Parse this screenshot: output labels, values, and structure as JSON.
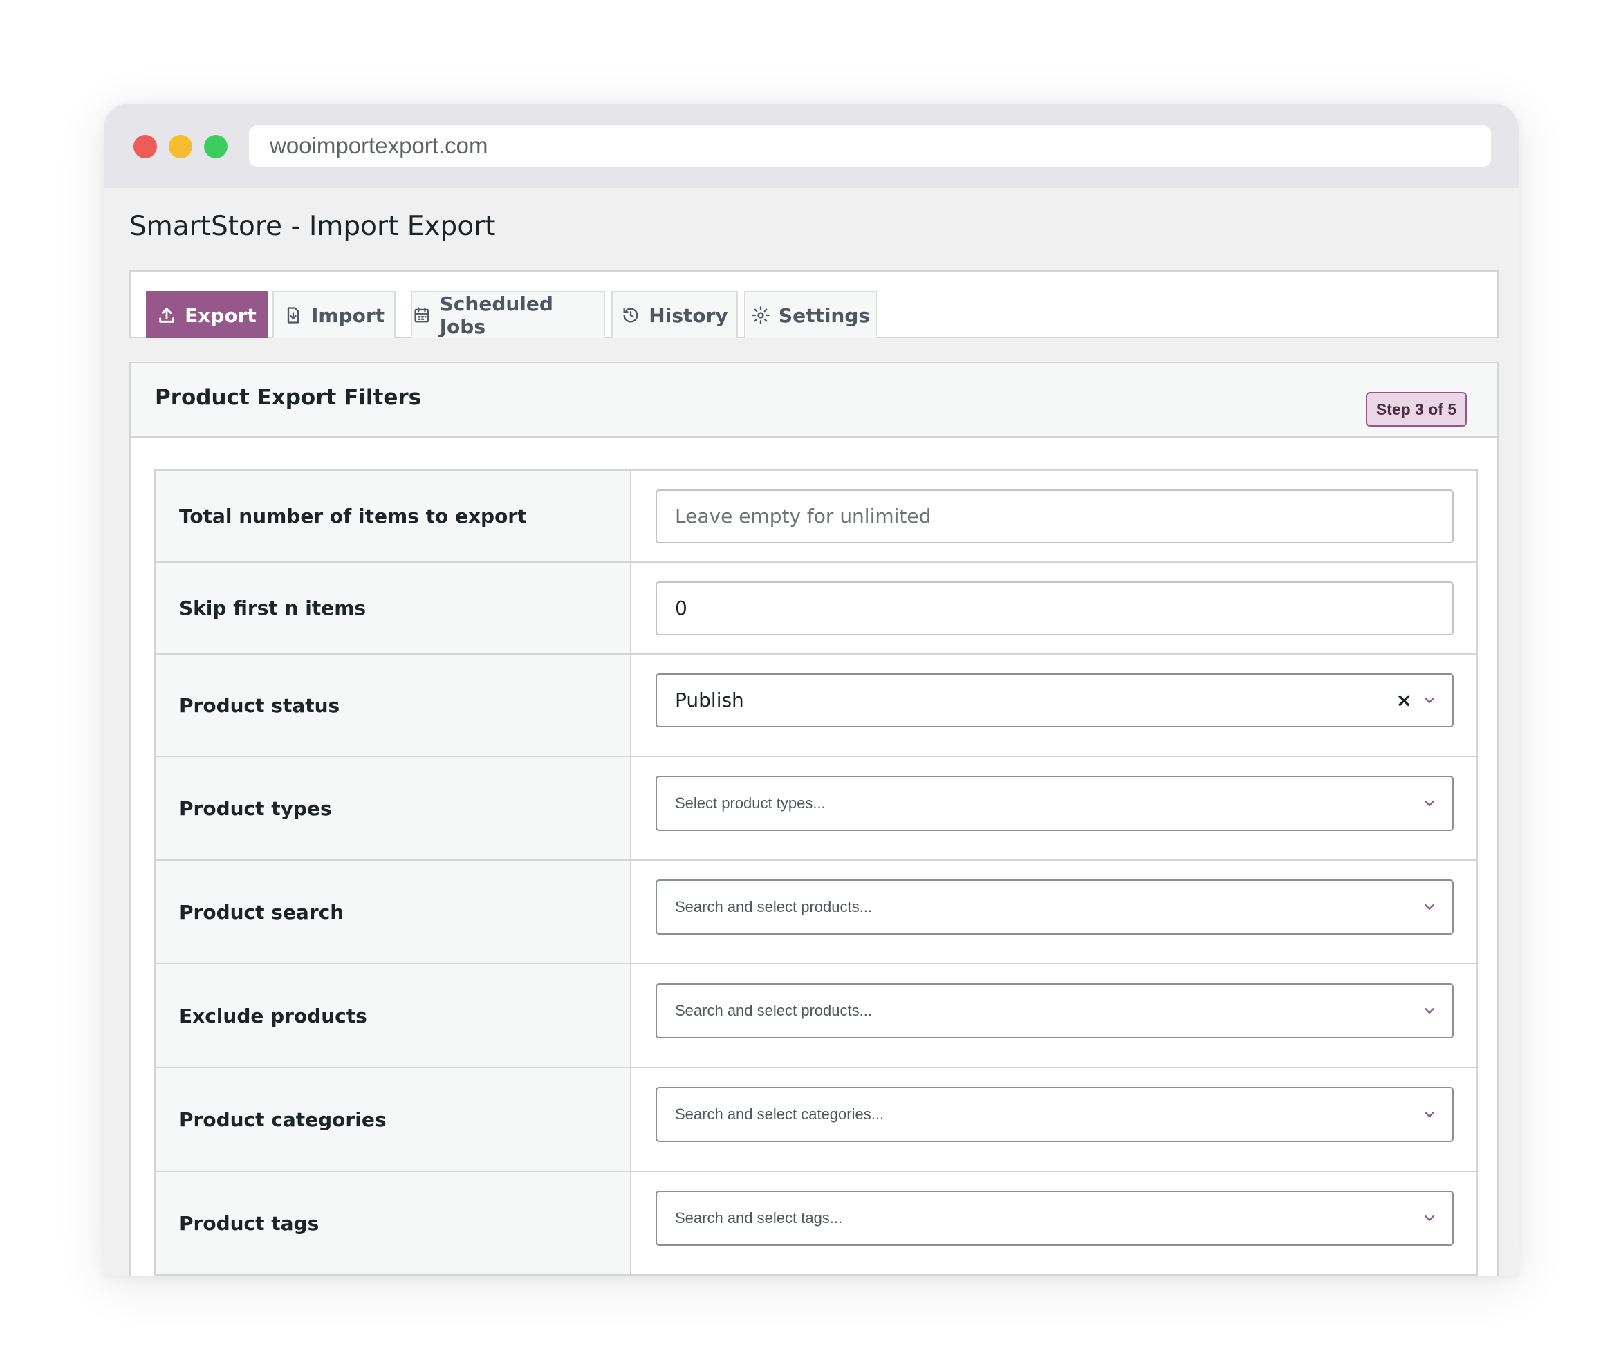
{
  "browser": {
    "url": "wooimportexport.com"
  },
  "app": {
    "title": "SmartStore - Import Export"
  },
  "tabs": [
    {
      "label": "Export",
      "icon": "upload-icon",
      "active": true
    },
    {
      "label": "Import",
      "icon": "import-file-icon",
      "active": false
    },
    {
      "label": "Scheduled Jobs",
      "icon": "calendar-icon",
      "active": false
    },
    {
      "label": "History",
      "icon": "history-icon",
      "active": false
    },
    {
      "label": "Settings",
      "icon": "gear-icon",
      "active": false
    }
  ],
  "panel": {
    "title": "Product Export Filters",
    "step": "Step 3 of 5"
  },
  "fields": {
    "total_items": {
      "label": "Total number of items to export",
      "placeholder": "Leave empty for unlimited",
      "value": ""
    },
    "skip_items": {
      "label": "Skip first n items",
      "value": "0"
    },
    "status": {
      "label": "Product status",
      "value": "Publish",
      "clear": "×"
    },
    "types": {
      "label": "Product types",
      "placeholder": "Select product types..."
    },
    "search": {
      "label": "Product search",
      "placeholder": "Search and select products..."
    },
    "exclude": {
      "label": "Exclude products",
      "placeholder": "Search and select products..."
    },
    "categories": {
      "label": "Product categories",
      "placeholder": "Search and select categories..."
    },
    "tags": {
      "label": "Product tags",
      "placeholder": "Search and select tags..."
    }
  },
  "colors": {
    "accent": "#96588a",
    "badge_bg": "#ead7e6",
    "window_bg": "#f0f0f1"
  }
}
